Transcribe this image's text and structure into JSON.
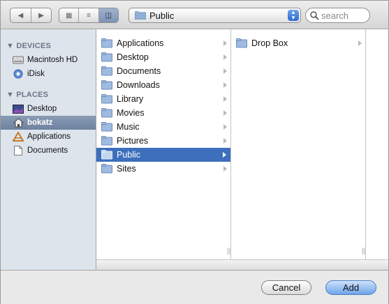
{
  "toolbar": {
    "back_icon": "back-arrow-icon",
    "forward_icon": "forward-arrow-icon",
    "view_modes": [
      "icon-view",
      "list-view",
      "column-view"
    ],
    "selected_view": "column-view",
    "location": "Public",
    "search_placeholder": "search"
  },
  "sidebar": {
    "devices_header": "DEVICES",
    "devices": [
      {
        "label": "Macintosh HD",
        "icon": "hard-drive-icon"
      },
      {
        "label": "iDisk",
        "icon": "idisk-icon"
      }
    ],
    "places_header": "PLACES",
    "places": [
      {
        "label": "Desktop",
        "icon": "desktop-icon"
      },
      {
        "label": "bokatz",
        "icon": "home-icon",
        "selected": true
      },
      {
        "label": "Applications",
        "icon": "applications-icon"
      },
      {
        "label": "Documents",
        "icon": "document-icon"
      }
    ]
  },
  "column1": {
    "items": [
      {
        "label": "Applications"
      },
      {
        "label": "Desktop"
      },
      {
        "label": "Documents"
      },
      {
        "label": "Downloads"
      },
      {
        "label": "Library"
      },
      {
        "label": "Movies"
      },
      {
        "label": "Music"
      },
      {
        "label": "Pictures"
      },
      {
        "label": "Public",
        "selected": true
      },
      {
        "label": "Sites"
      }
    ]
  },
  "column2": {
    "items": [
      {
        "label": "Drop Box"
      }
    ]
  },
  "buttons": {
    "cancel": "Cancel",
    "add": "Add"
  },
  "colors": {
    "selection": "#3d6fbd",
    "sidebar_bg": "#dde4ec",
    "sidebar_selection": "#7a8dab"
  }
}
